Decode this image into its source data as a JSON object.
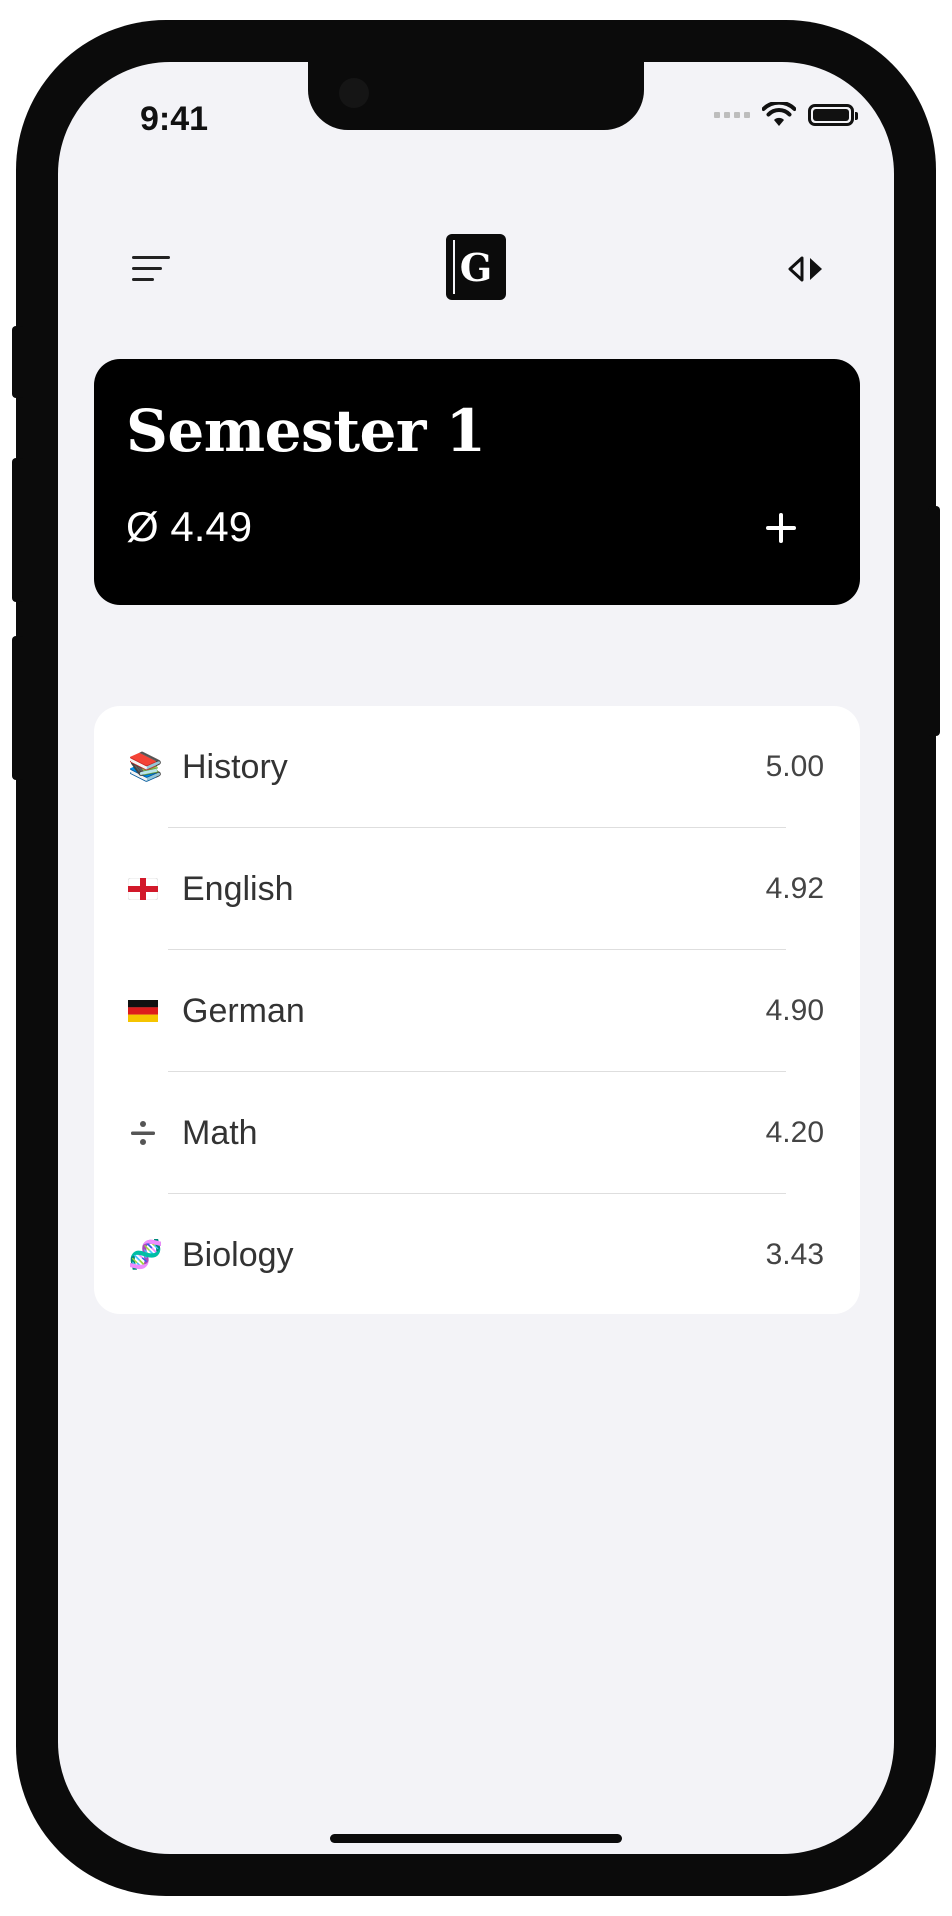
{
  "status_bar": {
    "time": "9:41"
  },
  "header": {
    "logo_letter": "G"
  },
  "semester_card": {
    "title": "Semester 1",
    "average": "Ø 4.49"
  },
  "subjects": [
    {
      "icon": "books-icon",
      "emoji": "📚",
      "label": "History",
      "value": "5.00"
    },
    {
      "icon": "england-flag-icon",
      "emoji": "🏴",
      "label": "English",
      "value": "4.92"
    },
    {
      "icon": "germany-flag-icon",
      "emoji": "🇩🇪",
      "label": "German",
      "value": "4.90"
    },
    {
      "icon": "divide-icon",
      "emoji": "➗",
      "label": "Math",
      "value": "4.20"
    },
    {
      "icon": "dna-icon",
      "emoji": "🧬",
      "label": "Biology",
      "value": "3.43"
    }
  ],
  "colors": {
    "background": "#f3f3f7",
    "card": "#000000",
    "list_bg": "#ffffff",
    "text": "#333333"
  }
}
